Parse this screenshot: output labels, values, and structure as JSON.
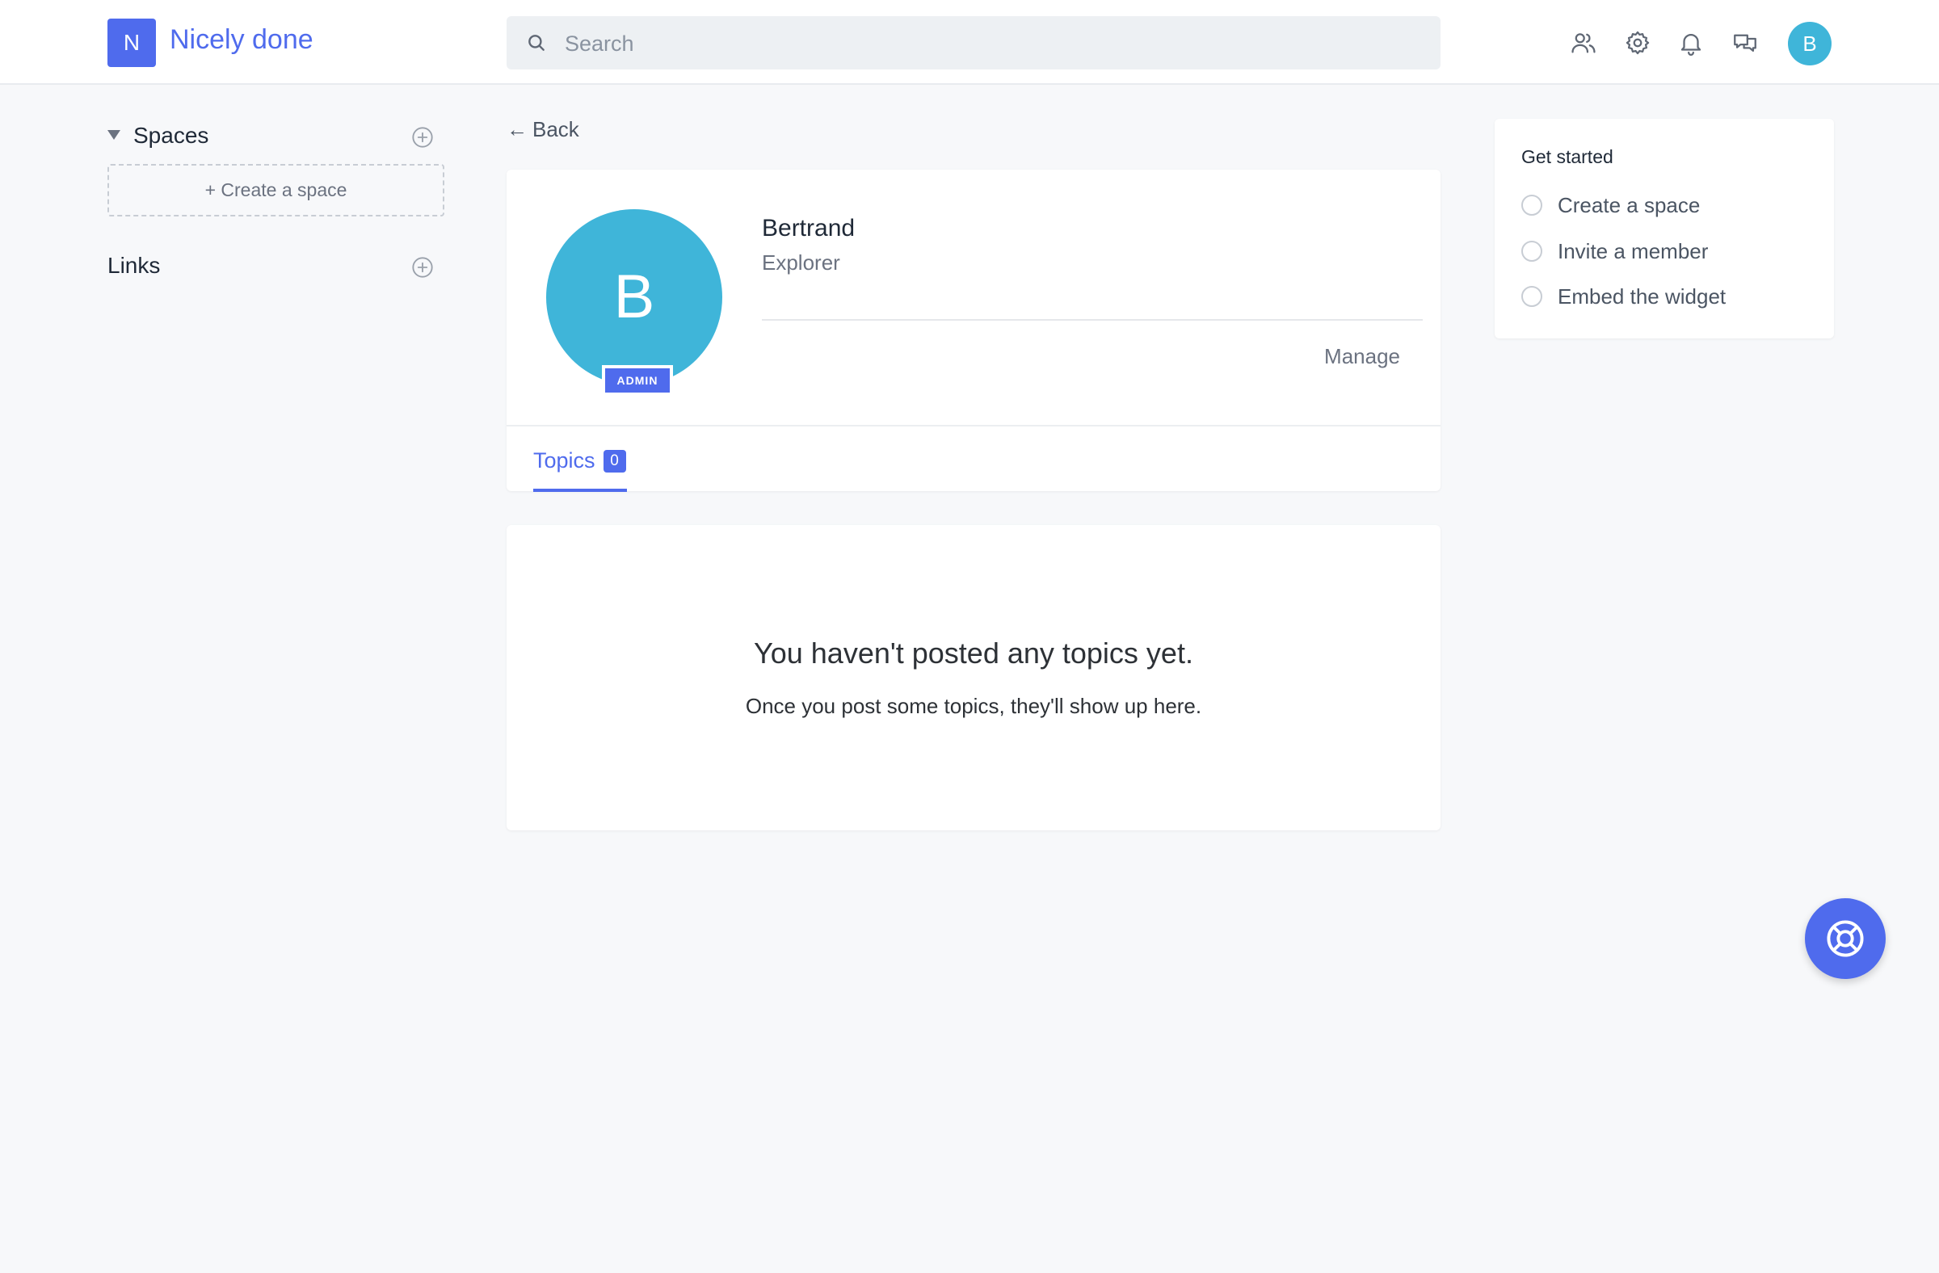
{
  "header": {
    "logo_letter": "N",
    "brand_name": "Nicely done",
    "search_placeholder": "Search",
    "avatar_letter": "B",
    "icons": [
      "members-icon",
      "settings-icon",
      "bell-icon",
      "chat-icon"
    ]
  },
  "sidebar": {
    "spaces_title": "Spaces",
    "create_space_label": "+ Create a space",
    "links_title": "Links"
  },
  "main": {
    "back_label": "Back",
    "profile": {
      "avatar_letter": "B",
      "badge": "ADMIN",
      "name": "Bertrand",
      "role": "Explorer",
      "manage_label": "Manage"
    },
    "tabs": [
      {
        "label": "Topics",
        "count": "0"
      }
    ],
    "empty_state": {
      "title": "You haven't posted any topics yet.",
      "subtitle": "Once you post some topics, they'll show up here."
    }
  },
  "get_started": {
    "title": "Get started",
    "items": [
      {
        "label": "Create a space"
      },
      {
        "label": "Invite a member"
      },
      {
        "label": "Embed the widget"
      }
    ]
  },
  "colors": {
    "accent": "#4f6bed",
    "avatar": "#3fb5d9",
    "background": "#f7f8fa"
  }
}
